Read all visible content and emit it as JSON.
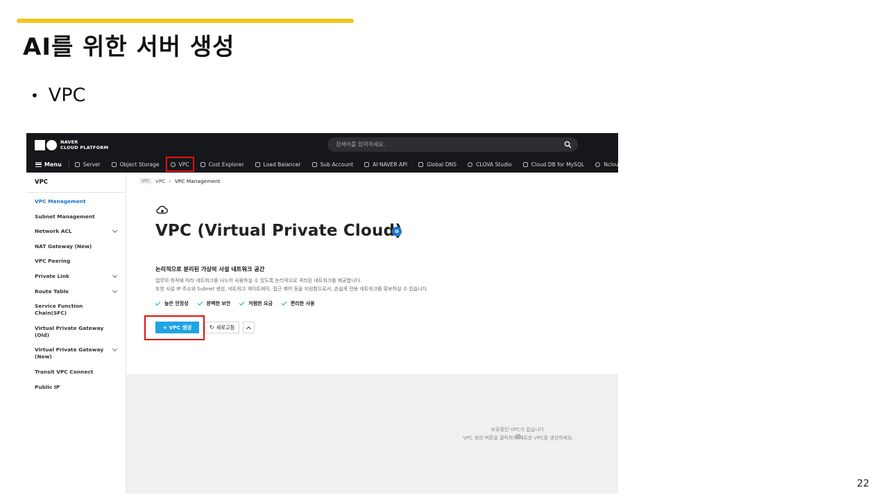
{
  "slide": {
    "title": "AI를 위한 서버 생성",
    "bullet": "VPC",
    "page_number": "22",
    "accent_color": "#f5c518"
  },
  "console": {
    "logo": {
      "line1": "NAVER",
      "line2": "CLOUD PLATFORM"
    },
    "search": {
      "placeholder": "검색어를 입력하세요."
    },
    "nav": {
      "menu_label": "Menu",
      "items": [
        {
          "label": "Server",
          "icon": "server-icon"
        },
        {
          "label": "Object Storage",
          "icon": "storage-icon"
        },
        {
          "label": "VPC",
          "icon": "vpc-cloud-icon",
          "highlighted": true
        },
        {
          "label": "Cost Explorer",
          "icon": "cost-icon"
        },
        {
          "label": "Load Balancer",
          "icon": "load-balancer-icon"
        },
        {
          "label": "Sub Account",
          "icon": "users-icon"
        },
        {
          "label": "AI·NAVER API",
          "icon": "api-icon"
        },
        {
          "label": "Global DNS",
          "icon": "dns-icon"
        },
        {
          "label": "CLOVA Studio",
          "icon": "clova-icon"
        },
        {
          "label": "Cloud DB for MySQL",
          "icon": "database-icon"
        },
        {
          "label": "Ncloud Kubern",
          "icon": "kubernetes-icon"
        }
      ]
    },
    "sidebar": {
      "title": "VPC",
      "items": [
        {
          "label": "VPC Management",
          "active": true,
          "expandable": false
        },
        {
          "label": "Subnet Management",
          "expandable": false
        },
        {
          "label": "Network ACL",
          "expandable": true
        },
        {
          "label": "NAT Gateway (New)",
          "expandable": false
        },
        {
          "label": "VPC Peering",
          "expandable": false
        },
        {
          "label": "Private Link",
          "expandable": true
        },
        {
          "label": "Route Table",
          "expandable": true
        },
        {
          "label": "Service Function",
          "label2": "Chain(SFC)",
          "expandable": false
        },
        {
          "label": "Virtual Private Gateway",
          "label2": "(Old)",
          "expandable": false
        },
        {
          "label": "Virtual Private Gateway",
          "label2": "(New)",
          "expandable": true
        },
        {
          "label": "Transit VPC Connect",
          "expandable": false
        },
        {
          "label": "Public IP",
          "expandable": false
        }
      ]
    },
    "breadcrumb": {
      "tag": "VPC",
      "parent": "VPC",
      "current": "VPC Management"
    },
    "main": {
      "title": "VPC (Virtual Private Cloud)",
      "info_badge": "o",
      "description_title": "논리적으로 분리된 가상의 사설 네트워크 공간",
      "description_line1": "업무의 목적에 따라 네트워크를 나누어 사용하실 수 있도록 논리적으로 격리된 네트워크를 제공합니다.",
      "description_line2": "또한 사설 IP 주소와 Subnet 생성, 네트워크 게이트웨이, 접근 제어 등을 지원함으로서, 손쉽게 전용 네트워크를 확보하실 수 있습니다.",
      "features": [
        "높은 안정성",
        "완벽한 보안",
        "저렴한 요금",
        "편리한 사용"
      ],
      "create_button": "+ VPC 생성",
      "refresh_button": "새로고침",
      "empty_line1": "보유중인 VPC가 없습니다.",
      "empty_line2": "VPC 생성 버튼을 클릭하여 새로운 VPC를 생성하세요."
    },
    "colors": {
      "header_bg": "#16171b",
      "primary_button": "#1fa3e3",
      "active_link": "#1a73c9",
      "highlight_frame": "#e0120f"
    }
  }
}
